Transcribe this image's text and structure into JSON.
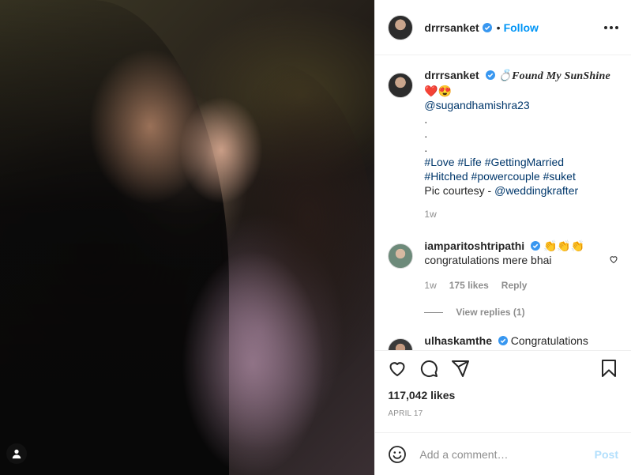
{
  "post": {
    "username": "drrrsanket",
    "follow_label": "Follow",
    "dot": "•"
  },
  "caption": {
    "username": "drrrsanket",
    "title": "💍Found My SunShine",
    "emojis": "❤️😍",
    "mention": "@sugandhamishra23",
    "dots": [
      ".",
      ".",
      "."
    ],
    "hashtags_line1": "#Love #Life #GettingMarried",
    "hashtags_line2": "#Hitched #powercouple #suket",
    "credit_prefix": "Pic courtesy - ",
    "credit_mention": "@weddingkrafter",
    "time": "1w"
  },
  "comments": [
    {
      "username": "iamparitoshtripathi",
      "emoji": "👏👏👏",
      "text": "congratulations mere bhai",
      "time": "1w",
      "likes": "175 likes",
      "reply": "Reply",
      "view_replies": "View replies (1)"
    },
    {
      "username": "ulhaskamthe",
      "text": "Congratulations"
    }
  ],
  "stats": {
    "likes": "117,042 likes",
    "date": "APRIL 17"
  },
  "composer": {
    "placeholder": "Add a comment…",
    "post_label": "Post"
  },
  "colors": {
    "link": "#00376b",
    "follow": "#0095f6",
    "post_disabled": "#b2dffc",
    "muted": "#8e8e8e"
  }
}
